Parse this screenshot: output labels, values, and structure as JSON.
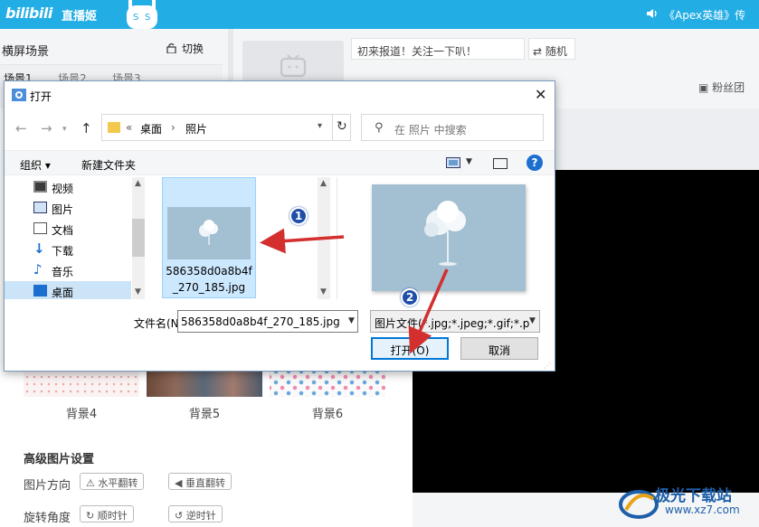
{
  "app": {
    "logo": "bilibili",
    "title": "直播姬",
    "marquee": "《Apex英雄》传"
  },
  "scene": {
    "title": "横屏场景",
    "switch_label": "切换",
    "tabs": [
      "场景1",
      "场景2",
      "场景3"
    ]
  },
  "header": {
    "notice": "初来报道！关注一下叭！",
    "random_label": "随机",
    "fan_group": "粉丝团"
  },
  "backgrounds": {
    "items": [
      {
        "label": "背景4"
      },
      {
        "label": "背景5"
      },
      {
        "label": "背景6"
      }
    ],
    "advanced_title": "高级图片设置",
    "direction_label": "图片方向",
    "flip_h": "水平翻转",
    "flip_v": "垂直翻转",
    "rotate_label": "旋转角度",
    "rotate_cw": "顺时针",
    "rotate_ccw": "逆时针"
  },
  "dialog": {
    "title": "打开",
    "address": {
      "prefix": "«",
      "crumbs": [
        "桌面",
        "照片"
      ]
    },
    "search_placeholder": "在 照片 中搜索",
    "toolbar": {
      "organize": "组织 ▾",
      "new_folder": "新建文件夹"
    },
    "nav_items": [
      {
        "label": "视频",
        "icon": "video-icon"
      },
      {
        "label": "图片",
        "icon": "pictures-icon"
      },
      {
        "label": "文档",
        "icon": "documents-icon"
      },
      {
        "label": "下载",
        "icon": "downloads-icon"
      },
      {
        "label": "音乐",
        "icon": "music-icon"
      },
      {
        "label": "桌面",
        "icon": "desktop-icon"
      }
    ],
    "file": {
      "name_line1": "586358d0a8b4f",
      "name_line2": "_270_185.jpg"
    },
    "filename_label": "文件名(N):",
    "filename_value": "586358d0a8b4f_270_185.jpg",
    "filetype_value": "图片文件(*.jpg;*.jpeg;*.gif;*.p",
    "open_label": "打开(O)",
    "cancel_label": "取消"
  },
  "annotations": {
    "step1": "1",
    "step2": "2",
    "color": "#d32f2f"
  },
  "watermark": {
    "text": "极光下载站",
    "url": "www.xz7.com"
  }
}
